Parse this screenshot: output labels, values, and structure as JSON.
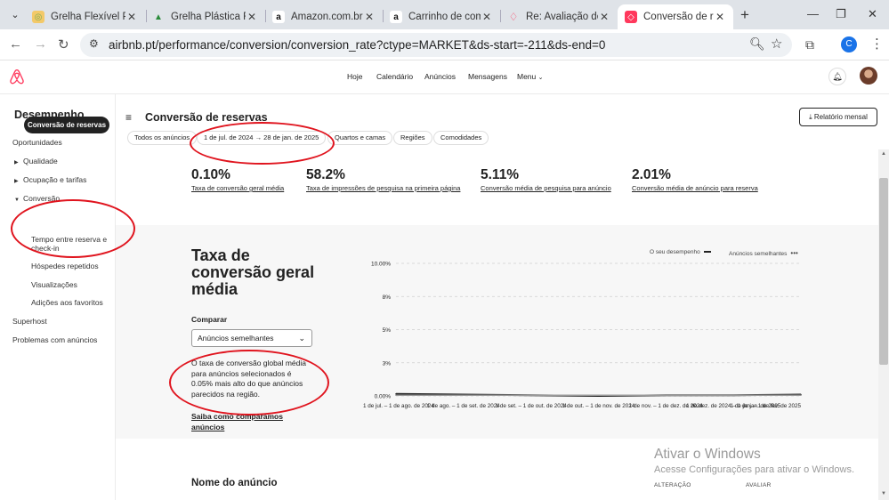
{
  "browser": {
    "tabs": [
      {
        "title": "Grelha Flexível Plá",
        "favicon": "tab-favicon-grill-icon"
      },
      {
        "title": "Grelha Plástica Fle",
        "favicon": "tab-favicon-plastic-icon"
      },
      {
        "title": "Amazon.com.br : g",
        "favicon": "amazon-favicon-icon"
      },
      {
        "title": "Carrinho de comp",
        "favicon": "amazon-favicon-icon"
      },
      {
        "title": "Re: Avaliação do m",
        "favicon": "airbnb-favicon-icon"
      },
      {
        "title": "Conversão de rese",
        "favicon": "airbnb-favicon-icon"
      }
    ],
    "url": "airbnb.pt/performance/conversion/conversion_rate?ctype=MARKET&ds-start=-211&ds-end=0",
    "profile_initial": "C"
  },
  "header": {
    "nav": [
      "Hoje",
      "Calendário",
      "Anúncios",
      "Mensagens",
      "Menu"
    ]
  },
  "sidebar": {
    "title": "Desempenho",
    "items": {
      "oportunidades": "Oportunidades",
      "qualidade": "Qualidade",
      "ocupacao": "Ocupação e tarifas",
      "conversao": "Conversão",
      "conversao_reservas": "Conversão de reservas",
      "tempo_1": "Tempo entre reserva e",
      "tempo_2": "check-in",
      "hospedes": "Hóspedes repetidos",
      "visualizacoes": "Visualizações",
      "favoritos": "Adições aos favoritos",
      "superhost": "Superhost",
      "problemas": "Problemas com anúncios"
    }
  },
  "main": {
    "title": "Conversão de reservas",
    "report_button": "Relatório mensal",
    "filters": {
      "all_listings": "Todos os anúncios",
      "date_start": "1 de jul. de 2024",
      "date_end": "28 de jan. de 2025",
      "rooms": "Quartos e camas",
      "regions": "Regiões",
      "amenities": "Comodidades"
    },
    "kpis": [
      {
        "value": "0.10%",
        "label": "Taxa de conversão geral média"
      },
      {
        "value": "58.2%",
        "label": "Taxa de impressões de pesquisa na primeira página"
      },
      {
        "value": "5.11%",
        "label": "Conversão média de pesquisa para anúncio"
      },
      {
        "value": "2.01%",
        "label": "Conversão média de anúncio para reserva"
      }
    ],
    "section": {
      "title_l1": "Taxa de",
      "title_l2": "conversão geral",
      "title_l3": "média",
      "compare_label": "Comparar",
      "compare_value": "Anúncios semelhantes",
      "description": "O taxa de conversão global média para anúncios selecionados é 0.05% mais alto do que anúncios parecidos na região.",
      "learn_more": "Saiba como comparamos anúncios"
    },
    "bottom": {
      "name_header": "Nome do anúncio",
      "col_change": "ALTERAÇÃO",
      "col_rate": "AVALIAR"
    }
  },
  "chart_data": {
    "type": "line",
    "title": "",
    "xlabel": "",
    "ylabel": "",
    "ylim": [
      0,
      10
    ],
    "y_ticks": [
      "10.00%",
      "8%",
      "5%",
      "3%",
      "0.00%"
    ],
    "categories": [
      "1 de jul. – 1 de ago. de 2024",
      "1 de ago. – 1 de set. de 2024",
      "1 de set. – 1 de out. de 2024",
      "1 de out. – 1 de nov. de 2024",
      "1 de nov. – 1 de dez. de 2024",
      "1 de dez. de 2024 – 1 de jan. de 2025",
      "1 de jan. – 1 de fev. de 2025"
    ],
    "series": [
      {
        "name": "O seu desempenho",
        "color": "#222222",
        "values": [
          0.15,
          0.1,
          0.05,
          0.0,
          0.05,
          0.05,
          0.1
        ]
      },
      {
        "name": "Anúncios semelhantes",
        "color": "#999999",
        "values": [
          0.05,
          0.05,
          0.05,
          0.05,
          0.05,
          0.05,
          0.05
        ]
      }
    ],
    "legend_position": "top-right",
    "grid": true
  },
  "os_watermark": {
    "line1": "Ativar o Windows",
    "line2": "Acesse Configurações para ativar o Windows."
  },
  "colors": {
    "brand": "#FF385C",
    "annotation": "#E0141E"
  }
}
